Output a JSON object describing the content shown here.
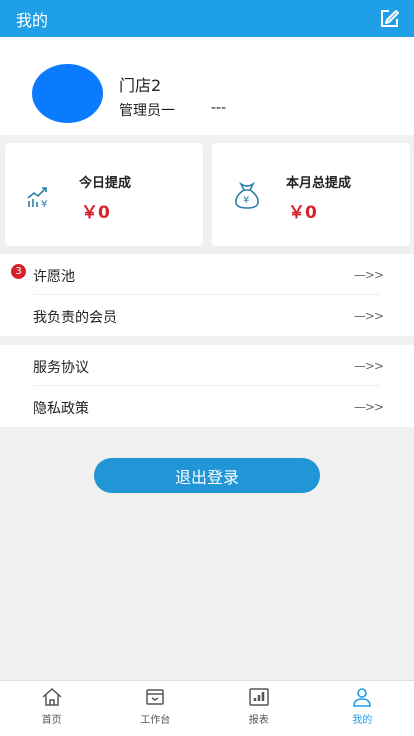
{
  "header": {
    "title": "我的"
  },
  "profile": {
    "store_name": "门店2",
    "role": "管理员一",
    "role_value": "---"
  },
  "stats": [
    {
      "label": "今日提成",
      "value": "￥0",
      "icon": "trend-chart-icon"
    },
    {
      "label": "本月总提成",
      "value": "￥0",
      "icon": "money-bag-icon"
    }
  ],
  "menu1": [
    {
      "label": "许愿池",
      "badge": "3",
      "arrow": "—>>"
    },
    {
      "label": "我负责的会员",
      "arrow": "—>>"
    }
  ],
  "menu2": [
    {
      "label": "服务协议",
      "arrow": "—>>"
    },
    {
      "label": "隐私政策",
      "arrow": "—>>"
    }
  ],
  "logout_label": "退出登录",
  "tabs": [
    {
      "label": "首页",
      "icon": "home-icon"
    },
    {
      "label": "工作台",
      "icon": "workbench-icon"
    },
    {
      "label": "报表",
      "icon": "report-icon"
    },
    {
      "label": "我的",
      "icon": "user-icon",
      "active": true
    }
  ],
  "colors": {
    "accent": "#1e9fe6",
    "avatar": "#0a7aff",
    "money": "#d7222d",
    "badge": "#d7222d"
  }
}
